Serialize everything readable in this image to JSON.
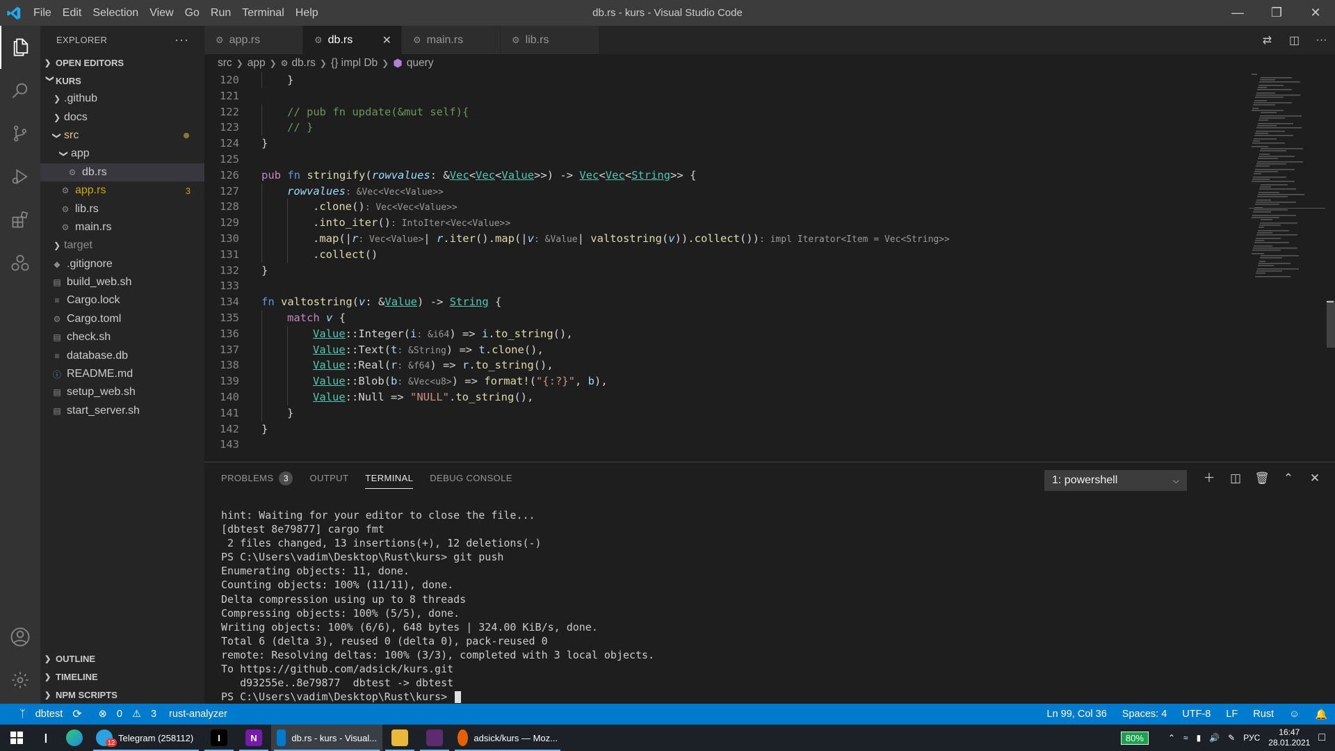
{
  "window": {
    "title": "db.rs - kurs - Visual Studio Code",
    "menu": [
      "File",
      "Edit",
      "Selection",
      "View",
      "Go",
      "Run",
      "Terminal",
      "Help"
    ]
  },
  "sidebar": {
    "header": "EXPLORER",
    "open_editors": "OPEN EDITORS",
    "project": "KURS",
    "tree": [
      {
        "label": ".github",
        "kind": "folder",
        "depth": 1,
        "expanded": false
      },
      {
        "label": "docs",
        "kind": "folder",
        "depth": 1,
        "expanded": false
      },
      {
        "label": "src",
        "kind": "folder",
        "depth": 1,
        "expanded": true,
        "modified": true,
        "color": "#e2c08d"
      },
      {
        "label": "app",
        "kind": "folder",
        "depth": 2,
        "expanded": true
      },
      {
        "label": "db.rs",
        "kind": "rust",
        "depth": 3,
        "selected": true
      },
      {
        "label": "app.rs",
        "kind": "rust",
        "depth": 2,
        "badge": "3",
        "color": "#cca700"
      },
      {
        "label": "lib.rs",
        "kind": "rust",
        "depth": 2
      },
      {
        "label": "main.rs",
        "kind": "rust",
        "depth": 2
      },
      {
        "label": "target",
        "kind": "folder",
        "depth": 1,
        "expanded": false,
        "color": "#8c8c8c"
      },
      {
        "label": ".gitignore",
        "kind": "git",
        "depth": 1
      },
      {
        "label": "build_web.sh",
        "kind": "file",
        "depth": 1
      },
      {
        "label": "Cargo.lock",
        "kind": "lines",
        "depth": 1
      },
      {
        "label": "Cargo.toml",
        "kind": "gear",
        "depth": 1
      },
      {
        "label": "check.sh",
        "kind": "file",
        "depth": 1
      },
      {
        "label": "database.db",
        "kind": "lines",
        "depth": 1
      },
      {
        "label": "README.md",
        "kind": "info",
        "depth": 1
      },
      {
        "label": "setup_web.sh",
        "kind": "file",
        "depth": 1
      },
      {
        "label": "start_server.sh",
        "kind": "file",
        "depth": 1
      }
    ],
    "bottom_sections": [
      "OUTLINE",
      "TIMELINE",
      "NPM SCRIPTS"
    ]
  },
  "tabs": [
    {
      "label": "app.rs",
      "active": false
    },
    {
      "label": "db.rs",
      "active": true
    },
    {
      "label": "main.rs",
      "active": false
    },
    {
      "label": "lib.rs",
      "active": false
    }
  ],
  "breadcrumb": [
    "src",
    "app",
    "db.rs",
    "{} impl Db",
    "query"
  ],
  "editor": {
    "lines": [
      {
        "n": "120",
        "indent": 1,
        "html": "}"
      },
      {
        "n": "121",
        "indent": 0,
        "html": ""
      },
      {
        "n": "122",
        "indent": 1,
        "html": "<span class=\"cm\">// pub fn update(&amp;mut self){</span>"
      },
      {
        "n": "123",
        "indent": 1,
        "html": "<span class=\"cm\">// }</span>"
      },
      {
        "n": "124",
        "indent": 0,
        "html": "}"
      },
      {
        "n": "125",
        "indent": 0,
        "html": ""
      },
      {
        "n": "126",
        "indent": 0,
        "html": "<span class=\"kw2\">pub</span> <span class=\"kw\">fn</span> <span class=\"fn\">stringify</span>(<span class=\"pa\">rowvalues</span>: &amp;<span class=\"tyu\">Vec</span>&lt;<span class=\"tyu\">Vec</span>&lt;<span class=\"tyu\">Value</span>&gt;&gt;) -&gt; <span class=\"tyu\">Vec</span>&lt;<span class=\"tyu\">Vec</span>&lt;<span class=\"tyu\">String</span>&gt;&gt; {"
      },
      {
        "n": "127",
        "indent": 1,
        "html": "<span class=\"pa\">rowvalues</span><span class=\"hint\">: &amp;Vec&lt;Vec&lt;Value&gt;&gt;</span>"
      },
      {
        "n": "128",
        "indent": 2,
        "html": ".<span class=\"fn\">clone</span>()<span class=\"hint\">: Vec&lt;Vec&lt;Value&gt;&gt;</span>"
      },
      {
        "n": "129",
        "indent": 2,
        "html": ".<span class=\"fn\">into_iter</span>()<span class=\"hint\">: IntoIter&lt;Vec&lt;Value&gt;&gt;</span>"
      },
      {
        "n": "130",
        "indent": 2,
        "html": ".<span class=\"fn\">map</span>(|<span class=\"pa\">r</span><span class=\"hint\">: Vec&lt;Value&gt;</span>| <span class=\"pa\">r</span>.<span class=\"fn\">iter</span>().<span class=\"fn\">map</span>(|<span class=\"pa\">v</span><span class=\"hint\">: &amp;Value</span>| <span class=\"fn\">valtostring</span>(<span class=\"pa\">v</span>)).<span class=\"fn\">collect</span>())<span class=\"hint\">: impl Iterator&lt;Item = Vec&lt;String&gt;&gt;</span>"
      },
      {
        "n": "131",
        "indent": 2,
        "html": ".<span class=\"fn\">collect</span>()"
      },
      {
        "n": "132",
        "indent": 0,
        "html": "}"
      },
      {
        "n": "133",
        "indent": 0,
        "html": ""
      },
      {
        "n": "134",
        "indent": 0,
        "html": "<span class=\"kw\">fn</span> <span class=\"fn\">valtostring</span>(<span class=\"pa\">v</span>: &amp;<span class=\"tyu\">Value</span>) -&gt; <span class=\"tyu\">String</span> {"
      },
      {
        "n": "135",
        "indent": 1,
        "html": "<span class=\"kw2\">match</span> <span class=\"pa\">v</span> {"
      },
      {
        "n": "136",
        "indent": 2,
        "html": "<span class=\"tyu\">Value</span>::Integer(<span class=\"va\">i</span><span class=\"hint\">: &amp;i64</span>) =&gt; <span class=\"va\">i</span>.<span class=\"fn\">to_string</span>(),"
      },
      {
        "n": "137",
        "indent": 2,
        "html": "<span class=\"tyu\">Value</span>::Text(<span class=\"va\">t</span><span class=\"hint\">: &amp;String</span>) =&gt; <span class=\"va\">t</span>.<span class=\"fn\">clone</span>(),"
      },
      {
        "n": "138",
        "indent": 2,
        "html": "<span class=\"tyu\">Value</span>::Real(<span class=\"va\">r</span><span class=\"hint\">: &amp;f64</span>) =&gt; <span class=\"va\">r</span>.<span class=\"fn\">to_string</span>(),"
      },
      {
        "n": "139",
        "indent": 2,
        "html": "<span class=\"tyu\">Value</span>::Blob(<span class=\"va\">b</span><span class=\"hint\">: &amp;Vec&lt;u8&gt;</span>) =&gt; <span class=\"fn\">format!</span>(<span class=\"str\">\"{:?}\"</span>, <span class=\"va\">b</span>),"
      },
      {
        "n": "140",
        "indent": 2,
        "html": "<span class=\"tyu\">Value</span>::Null =&gt; <span class=\"str\">\"NULL\"</span>.<span class=\"fn\">to_string</span>(),"
      },
      {
        "n": "141",
        "indent": 1,
        "html": "}"
      },
      {
        "n": "142",
        "indent": 0,
        "html": "}"
      },
      {
        "n": "143",
        "indent": 0,
        "html": ""
      }
    ]
  },
  "panel": {
    "tabs": [
      {
        "label": "PROBLEMS",
        "badge": "3",
        "active": false
      },
      {
        "label": "OUTPUT",
        "active": false
      },
      {
        "label": "TERMINAL",
        "active": true
      },
      {
        "label": "DEBUG CONSOLE",
        "active": false
      }
    ],
    "terminal_select": "1: powershell",
    "terminal_lines": [
      "hint: Waiting for your editor to close the file...",
      "[dbtest 8e79877] cargo fmt",
      " 2 files changed, 13 insertions(+), 12 deletions(-)",
      "PS C:\\Users\\vadim\\Desktop\\Rust\\kurs> git push",
      "Enumerating objects: 11, done.",
      "Counting objects: 100% (11/11), done.",
      "Delta compression using up to 8 threads",
      "Compressing objects: 100% (5/5), done.",
      "Writing objects: 100% (6/6), 648 bytes | 324.00 KiB/s, done.",
      "Total 6 (delta 3), reused 0 (delta 0), pack-reused 0",
      "remote: Resolving deltas: 100% (3/3), completed with 3 local objects.",
      "To https://github.com/adsick/kurs.git",
      "   d93255e..8e79877  dbtest -> dbtest",
      "PS C:\\Users\\vadim\\Desktop\\Rust\\kurs> "
    ]
  },
  "statusbar": {
    "branch": "dbtest",
    "errors": "0",
    "warnings": "3",
    "analyzer": "rust-analyzer",
    "position": "Ln 99, Col 36",
    "spaces": "Spaces: 4",
    "encoding": "UTF-8",
    "eol": "LF",
    "language": "Rust"
  },
  "taskbar": {
    "items": [
      {
        "label": "Telegram (258112)",
        "icon": "telegram-icon",
        "badge": "12",
        "color": "#2aa3e0"
      },
      {
        "label": "",
        "icon": "intellij-icon",
        "color": "#000000",
        "glyph": "I"
      },
      {
        "label": "",
        "icon": "onenote-icon",
        "color": "#7719aa",
        "glyph": "N"
      },
      {
        "label": "db.rs - kurs - Visual...",
        "icon": "vscode-icon",
        "color": "#007acc"
      },
      {
        "label": "",
        "icon": "file-explorer-icon",
        "color": "#e8b93a"
      },
      {
        "label": "",
        "icon": "app-icon",
        "color": "#5b2c6f"
      },
      {
        "label": "adsick/kurs — Moz...",
        "icon": "firefox-icon",
        "color": "#e66000"
      }
    ],
    "battery": "80%",
    "lang": "РУС",
    "time": "16:47",
    "date": "28.01.2021"
  }
}
